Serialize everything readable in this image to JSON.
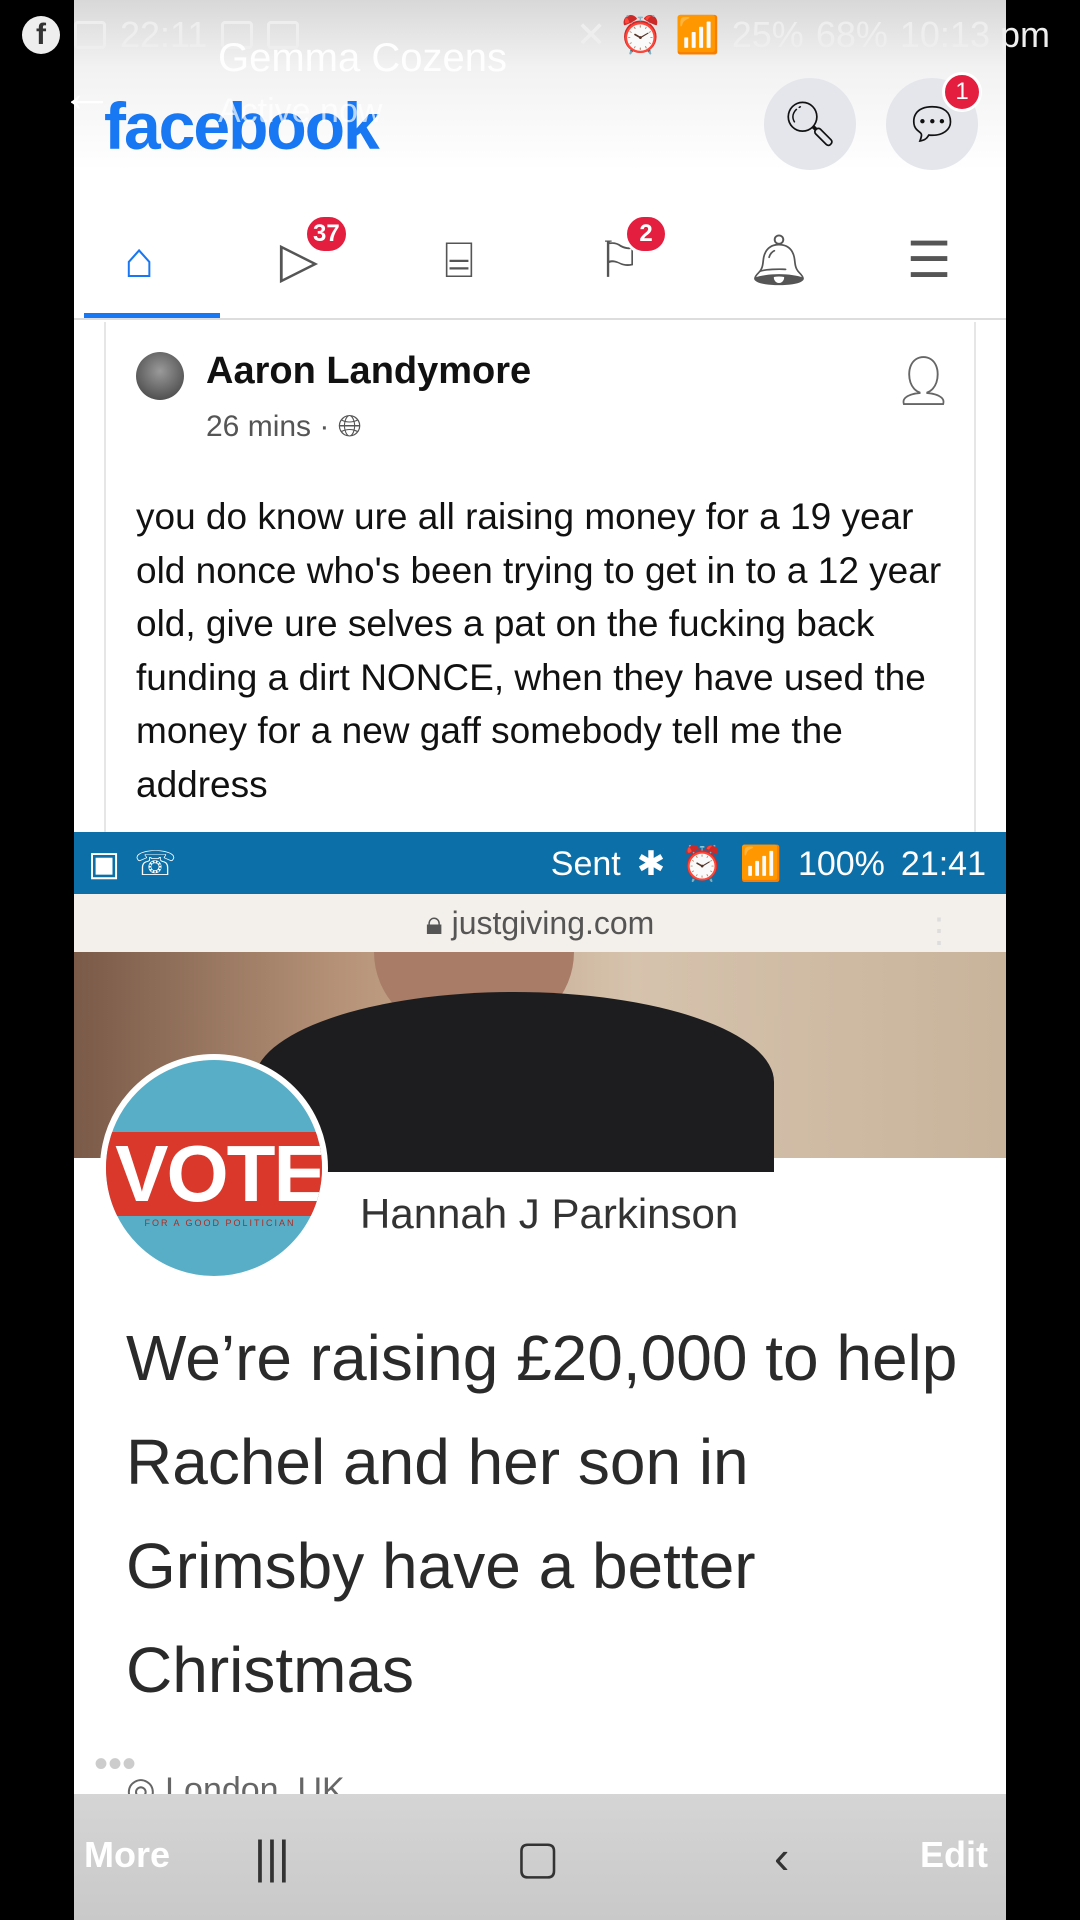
{
  "outer_status": {
    "time": "22:11",
    "battery": "68%",
    "signal": "25%",
    "overlay_time": "10:13 pm"
  },
  "conversation": {
    "name": "Gemma Cozens",
    "status": "Active now"
  },
  "facebook": {
    "logo": "facebook",
    "messenger_badge": "1",
    "nav": {
      "watch_badge": "37",
      "pages_badge": "2"
    }
  },
  "post": {
    "author": "Aaron Landymore",
    "time": "26 mins",
    "text": "you do know ure all raising money for a 19 year old nonce who's been trying to get in to a 12 year old, give ure selves a pat on the fucking back funding a dirt NONCE,  when they have used the money for a new gaff somebody tell me the address"
  },
  "embedded": {
    "status": {
      "sent": "Sent",
      "battery": "100%",
      "time": "21:41"
    },
    "url": "justgiving.com",
    "vote_text": "VOTE",
    "vote_subtext": "FOR A GOOD POLITICIAN",
    "organiser": "Hannah J Parkinson",
    "headline": "We’re raising £20,000 to help Rachel and her son in Grimsby have a better Christmas",
    "location": "London, UK"
  },
  "bottom_bar": {
    "more": "More",
    "edit": "Edit"
  },
  "colors": {
    "facebook_blue": "#1877f2",
    "badge_red": "#e41e3f",
    "inner_status_blue": "#0d6fa8",
    "vote_red": "#d9382b",
    "vote_blue": "#58aec7"
  }
}
